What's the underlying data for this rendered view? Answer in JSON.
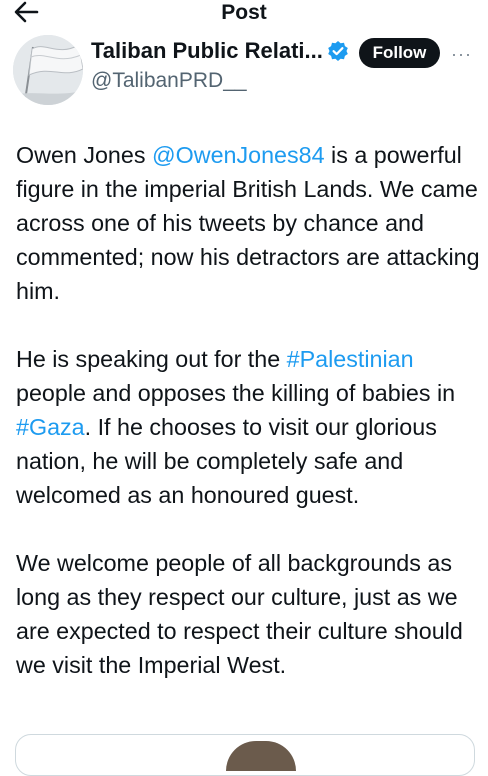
{
  "header": {
    "title": "Post",
    "back_icon": "arrow-left-icon"
  },
  "author": {
    "name": "Taliban Public Relati...",
    "handle": "@TalibanPRD__",
    "verified_icon": "verified-badge-icon",
    "verified_color": "#1d9bf0",
    "follow_label": "Follow",
    "more_icon": "more-options-icon",
    "more_glyph": "···"
  },
  "tweet": {
    "p1": {
      "t1": "Owen Jones ",
      "mention": "@OwenJones84",
      "t2": " is a powerful figure in the imperial British Lands. We came across one of his tweets by chance and commented; now his detractors are attacking him."
    },
    "p2": {
      "t1": "He is speaking out for the ",
      "hashtag1": "#Palestinian",
      "t2": " people and opposes the killing of babies in ",
      "hashtag2": "#Gaza",
      "t3": ".  If he chooses to visit our glorious nation, he will be completely safe and welcomed as an honoured guest."
    },
    "p3": "We welcome people of all backgrounds as long as they respect our culture, just as we are expected to respect their culture should we visit the Imperial West."
  },
  "colors": {
    "link": "#1d9bf0",
    "text": "#0f1419",
    "secondary": "#536471",
    "button_bg": "#0f1419"
  }
}
